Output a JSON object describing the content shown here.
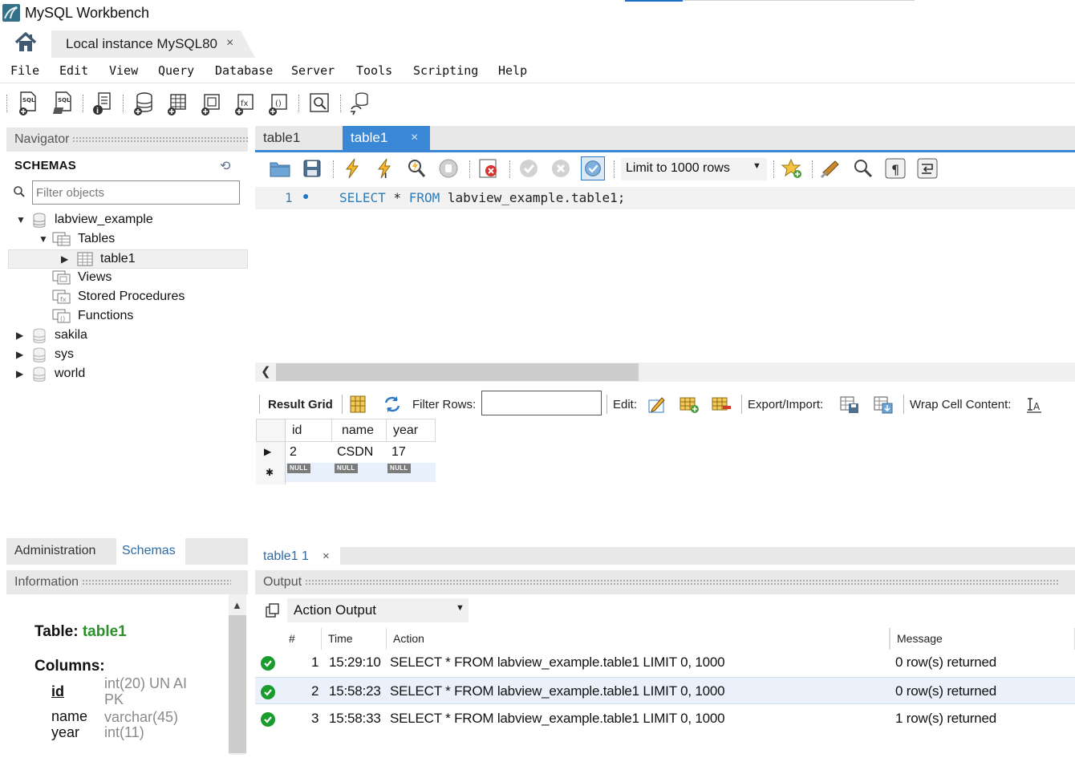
{
  "window": {
    "title": "MySQL Workbench"
  },
  "connection_tab": {
    "label": "Local instance MySQL80",
    "close": "×"
  },
  "menu": [
    "File",
    "Edit",
    "View",
    "Query",
    "Database",
    "Server",
    "Tools",
    "Scripting",
    "Help"
  ],
  "navigator": {
    "title": "Navigator",
    "section": "SCHEMAS",
    "filter_placeholder": "Filter objects",
    "tree": [
      {
        "label": "labview_example",
        "children": [
          {
            "label": "Tables",
            "children": [
              {
                "label": "table1",
                "selected": true
              }
            ]
          },
          {
            "label": "Views"
          },
          {
            "label": "Stored Procedures"
          },
          {
            "label": "Functions"
          }
        ]
      },
      {
        "label": "sakila"
      },
      {
        "label": "sys"
      },
      {
        "label": "world"
      }
    ],
    "tabs": [
      "Administration",
      "Schemas"
    ],
    "active_tab": "Schemas"
  },
  "information": {
    "title": "Information",
    "table_caption": "Table:",
    "table_name": "table1",
    "columns_caption": "Columns:",
    "columns": [
      {
        "name": "id",
        "type_line1": "int(20) UN AI",
        "type_line2": "PK"
      },
      {
        "name": "name",
        "type_line1": "varchar(45)"
      },
      {
        "name": "year",
        "type_line1": "int(11)"
      }
    ]
  },
  "editor": {
    "tabs": [
      "table1",
      "table1"
    ],
    "active_tab_index": 1,
    "tab_close": "×",
    "limit_label": "Limit to 1000 rows",
    "line_number": "1",
    "sql_keyword1": "SELECT",
    "sql_star": " * ",
    "sql_keyword2": "FROM",
    "sql_rest": " labview_example.table1;"
  },
  "result_toolbar": {
    "result_grid": "Result Grid",
    "filter_rows": "Filter Rows:",
    "edit": "Edit:",
    "export_import": "Export/Import:",
    "wrap": "Wrap Cell Content:"
  },
  "result_grid": {
    "columns": [
      "id",
      "name",
      "year"
    ],
    "rows": [
      [
        "2",
        "CSDN",
        "17"
      ]
    ],
    "null_label": "NULL"
  },
  "result_tab": {
    "label": "table1 1",
    "close": "×"
  },
  "output": {
    "title": "Output",
    "selector": "Action Output",
    "columns": [
      "#",
      "Time",
      "Action",
      "Message"
    ],
    "rows": [
      {
        "num": "1",
        "time": "15:29:10",
        "action": "SELECT * FROM labview_example.table1 LIMIT 0, 1000",
        "message": "0 row(s) returned",
        "status": "success"
      },
      {
        "num": "2",
        "time": "15:58:23",
        "action": "SELECT * FROM labview_example.table1 LIMIT 0, 1000",
        "message": "0 row(s) returned",
        "status": "success"
      },
      {
        "num": "3",
        "time": "15:58:33",
        "action": "SELECT * FROM labview_example.table1 LIMIT 0, 1000",
        "message": "1 row(s) returned",
        "status": "success"
      }
    ]
  },
  "colors": {
    "accent": "#3a87d6",
    "keyword": "#2e7db8",
    "success": "#1a9b2d",
    "table_name": "#2c8f2c"
  }
}
